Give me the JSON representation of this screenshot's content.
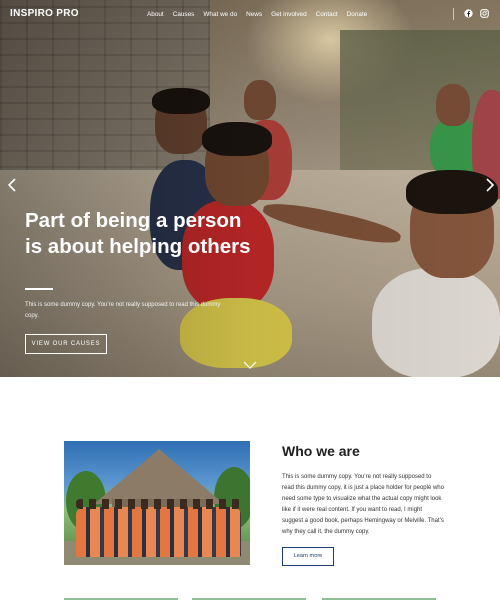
{
  "site": {
    "logo": "INSPIRO PRO"
  },
  "nav": {
    "items": [
      "About",
      "Causes",
      "What we do",
      "News",
      "Get involved",
      "Contact",
      "Donate"
    ],
    "social": [
      {
        "icon": "facebook-icon"
      },
      {
        "icon": "instagram-icon"
      }
    ]
  },
  "hero": {
    "title": "Part of being a person is about helping others",
    "subtitle": "This is some dummy copy. You’re not really supposed to read this dummy copy.",
    "button_label": "VIEW OUR CAUSES",
    "prev_icon": "chevron-left-icon",
    "next_icon": "chevron-right-icon",
    "scroll_icon": "chevron-down-icon"
  },
  "about": {
    "title": "Who we are",
    "text": "This is some dummy copy. You’re not really supposed to read this dummy copy, it is just a place holder for people who need some type to visualize what the actual copy might look like if it were real content. If you want to read, I might suggest a good book, perhaps Hemingway or Melville. That’s why they call it, the dummy copy.",
    "button_label": "Learn more"
  },
  "colors": {
    "accent": "#1e3f6e",
    "divider": "#8fbf95",
    "hero_shirt": "#c92a2a"
  }
}
